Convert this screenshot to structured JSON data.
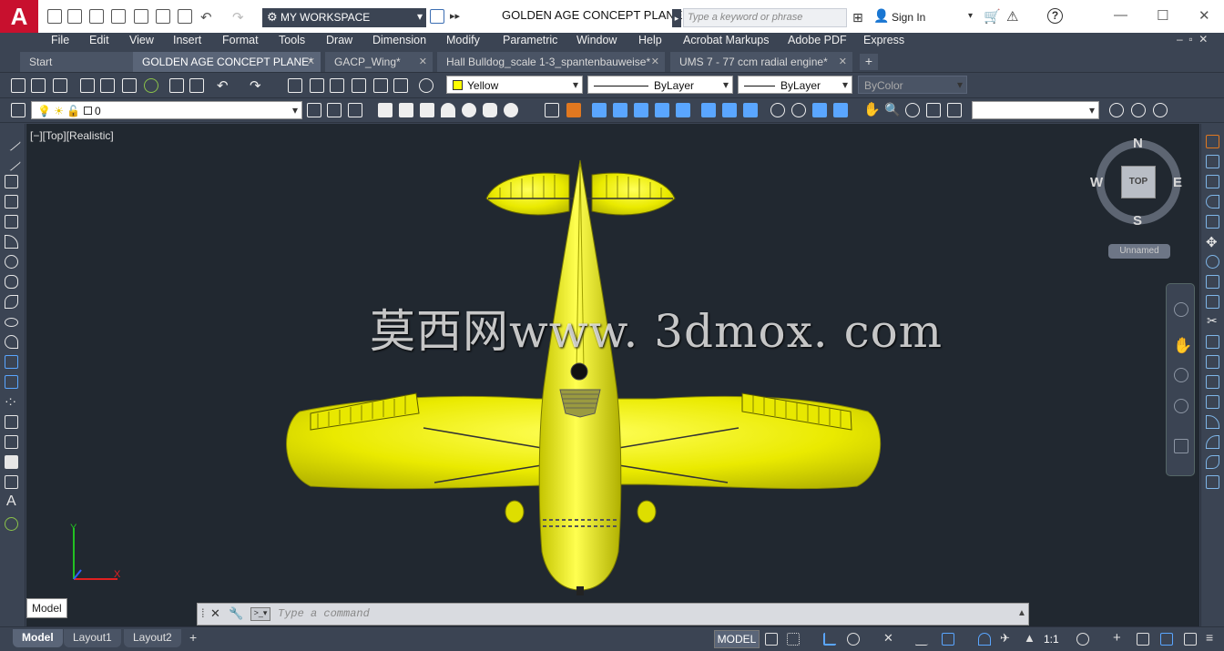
{
  "app": {
    "logo": "A",
    "title": "GOLDEN AGE CONCEPT PLANE.d...",
    "workspace": "MY WORKSPACE",
    "search_placeholder": "Type a keyword or phrase",
    "sign_in": "Sign In"
  },
  "menu": [
    "File",
    "Edit",
    "View",
    "Insert",
    "Format",
    "Tools",
    "Draw",
    "Dimension",
    "Modify",
    "Parametric",
    "Window",
    "Help",
    "Acrobat Markups",
    "Adobe PDF",
    "Express"
  ],
  "tabs": [
    {
      "label": "Start"
    },
    {
      "label": "GOLDEN AGE CONCEPT PLANE*"
    },
    {
      "label": "GACP_Wing*"
    },
    {
      "label": "Hall Bulldog_scale 1-3_spantenbauweise*"
    },
    {
      "label": "UMS 7 - 77 ccm radial engine*"
    }
  ],
  "properties": {
    "color": "Yellow",
    "linetype": "ByLayer",
    "lineweight": "ByLayer",
    "plotstyle": "ByColor",
    "layer": "0"
  },
  "viewport": {
    "label": "[−][Top][Realistic]",
    "watermark": "莫西网www. 3dmox. com",
    "viewcube": {
      "n": "N",
      "s": "S",
      "e": "E",
      "w": "W",
      "face": "TOP"
    },
    "ucs": "Unnamed",
    "tooltip": "Model"
  },
  "command": {
    "placeholder": "Type a command"
  },
  "status": {
    "layouts": [
      "Model",
      "Layout1",
      "Layout2"
    ],
    "model_button": "MODEL",
    "scale": "1:1"
  },
  "colors": {
    "accent": "#c8102e",
    "object": "#ffff00",
    "background": "#212830"
  }
}
